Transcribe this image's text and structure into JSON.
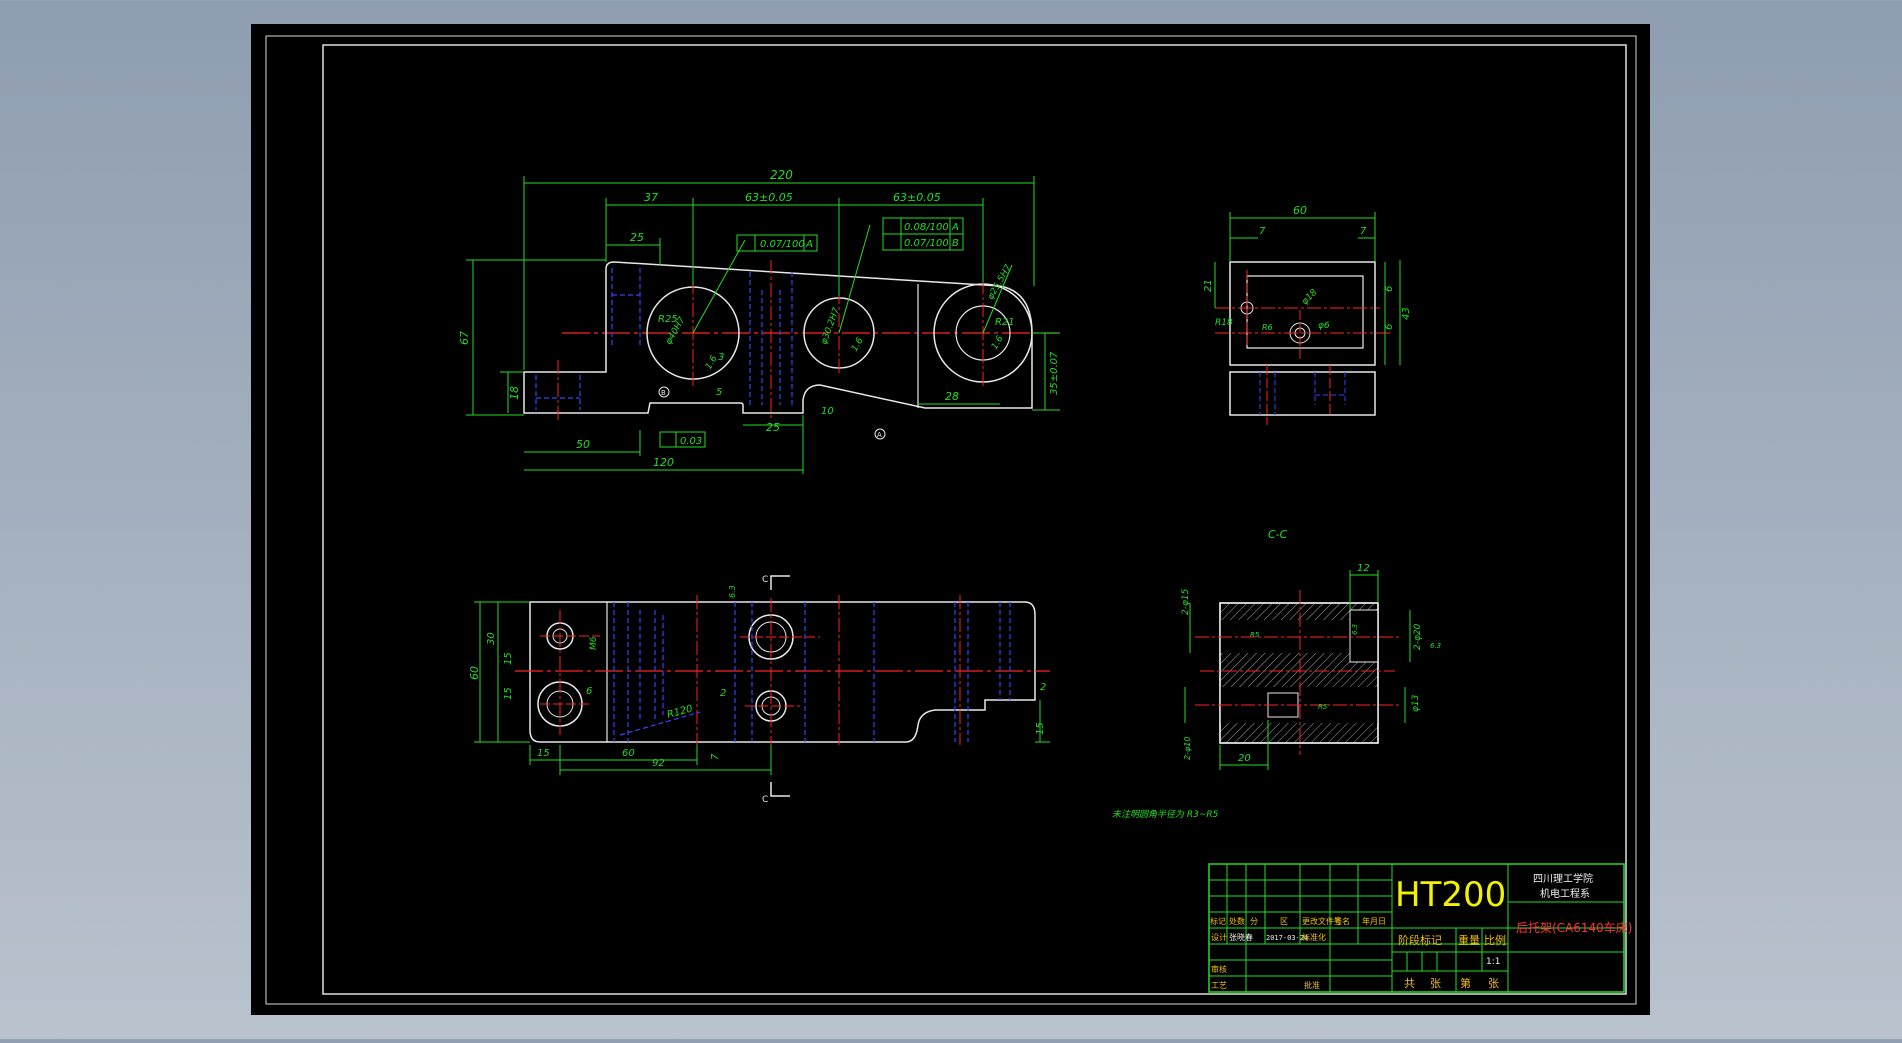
{
  "drawing": {
    "main_view": {
      "dim_overall_width": "220",
      "dim_37": "37",
      "dim_63_a": "63±0.05",
      "dim_63_b": "63±0.05",
      "dim_25_top": "25",
      "dim_67": "67",
      "dim_18": "18",
      "dim_50": "50",
      "dim_120": "120",
      "dim_25_bottom": "25",
      "dim_28": "28",
      "dim_35_tol": "35±0.07",
      "dim_10": "10",
      "dim_5": "5",
      "dim_3": "3",
      "radius_r25": "R25",
      "radius_r21": "R21",
      "bore_1": "φ40H7",
      "bore_2": "φ30.2H7",
      "bore_3": "φ25.5H7",
      "surface_1": "1.6",
      "surface_2": "1.6",
      "surface_3": "1.6",
      "tol_parallel_1": "0.07/100",
      "tol_parallel_1_ref": "A",
      "tol_parallel_2": "0.08/100",
      "tol_parallel_2_ref": "A",
      "tol_parallel_3": "0.07/100",
      "tol_parallel_3_ref": "B",
      "tol_flatness": "0.03",
      "datum_b": "B",
      "datum_a": "A"
    },
    "side_view": {
      "dim_60": "60",
      "dim_7_left": "7",
      "dim_7_right": "7",
      "dim_21": "21",
      "dim_6_top": "6",
      "dim_6_bottom": "6",
      "dim_43": "43",
      "r18": "R18",
      "phi18": "φ18",
      "phi6": "φ6",
      "r6": "R6"
    },
    "top_view": {
      "dim_60": "60",
      "dim_30": "30",
      "dim_15a": "15",
      "dim_15b": "15",
      "dim_15c": "15",
      "dim_15d": "15",
      "dim_60b": "60",
      "dim_92": "92",
      "dim_7": "7",
      "dim_2a": "2",
      "dim_2b": "2",
      "dim_6": "6",
      "m6": "M6",
      "r120": "R120",
      "section_mark_top": "C",
      "section_mark_bottom": "C",
      "surface": "6.3"
    },
    "section_view": {
      "label": "C-C",
      "dim_12": "12",
      "dim_20": "20",
      "phi15": "2-φ15",
      "phi20": "2-φ20",
      "phi13": "φ13",
      "phi10": "2-φ10",
      "r5_a": "R5",
      "r5_b": "R5",
      "surface_a": "6.3",
      "surface_b": "6.3"
    },
    "note": "未注明圆角半径为 R3~R5"
  },
  "title_block": {
    "material": "HT200",
    "school_line1": "四川理工学院",
    "school_line2": "机电工程系",
    "part_name": "后托架(CA6140车床)",
    "col_mark": "标记",
    "col_count": "处数",
    "col_zone": "分",
    "col_zone2": "区",
    "col_doc": "更改文件号",
    "col_sign": "签名",
    "col_date": "年月日",
    "design_label": "设计",
    "designer": "张晓春",
    "design_date": "2017-03-24",
    "std_label": "标准化",
    "stage_label": "阶段标记",
    "weight_label": "重量",
    "scale_label": "比例",
    "scale_value": "1:1",
    "review_label": "审核",
    "process_label": "工艺",
    "approve_label": "批准",
    "total_label": "共",
    "sheets_label": "张",
    "sheet_label": "第",
    "sheet_label2": "张"
  }
}
